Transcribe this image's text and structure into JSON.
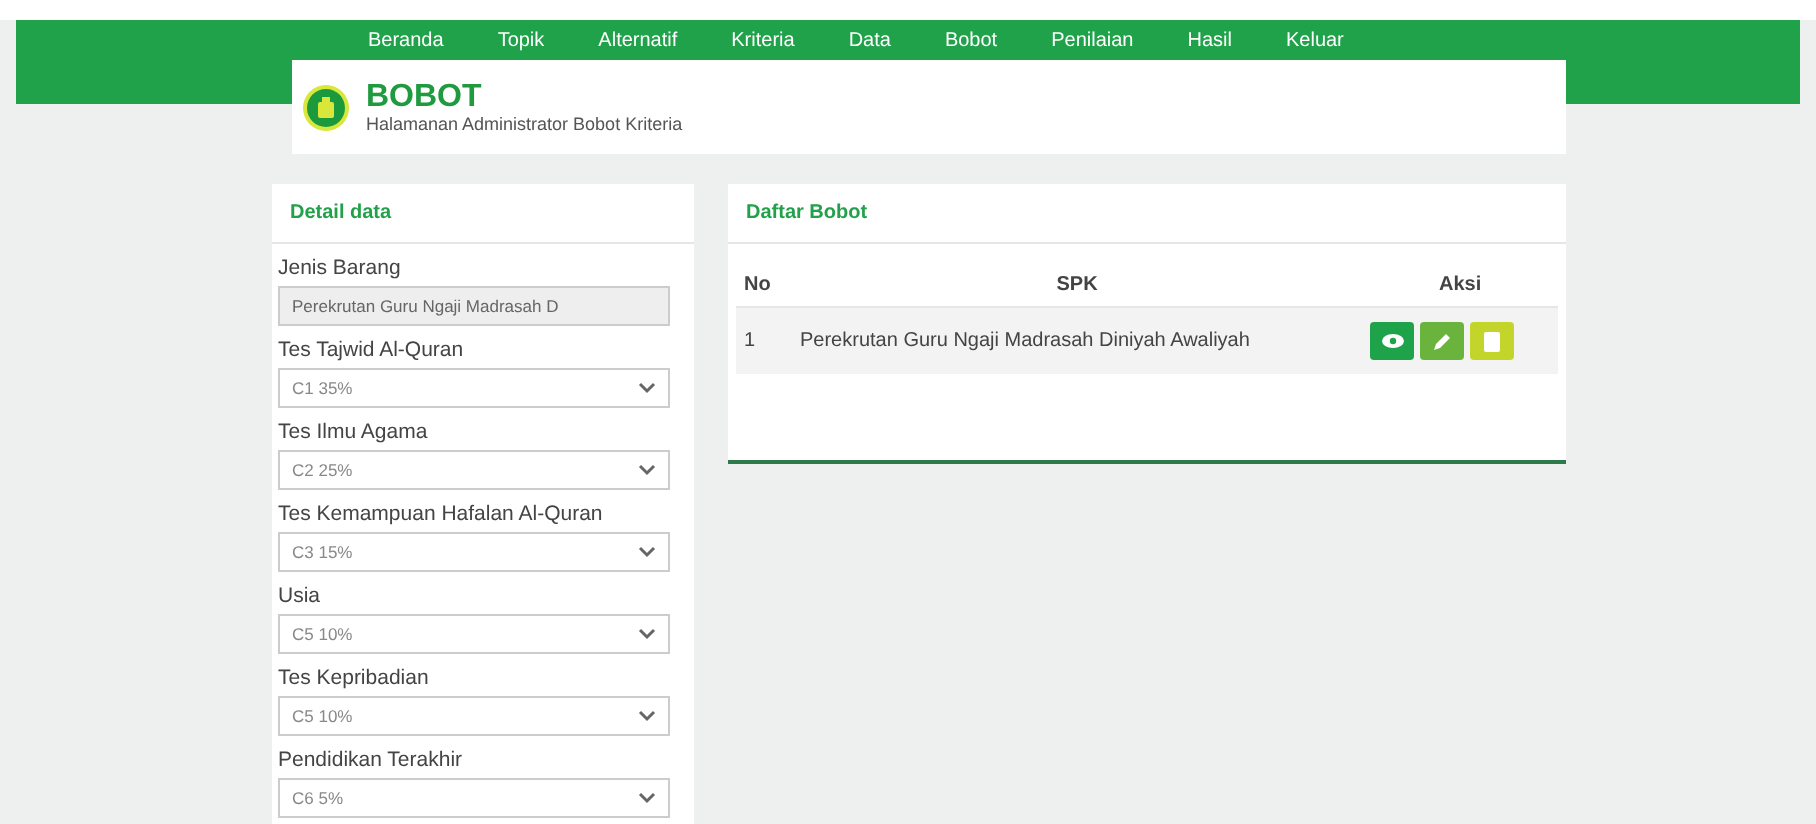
{
  "nav": [
    "Beranda",
    "Topik",
    "Alternatif",
    "Kriteria",
    "Data",
    "Bobot",
    "Penilaian",
    "Hasil",
    "Keluar"
  ],
  "header": {
    "title": "BOBOT",
    "subtitle": "Halamanan Administrator Bobot Kriteria"
  },
  "detail": {
    "title": "Detail data",
    "fields": [
      {
        "kind": "text",
        "label": "Jenis Barang",
        "value": "Perekrutan Guru Ngaji Madrasah D"
      },
      {
        "kind": "select",
        "label": "Tes Tajwid Al-Quran",
        "value": "C1 35%"
      },
      {
        "kind": "select",
        "label": "Tes Ilmu Agama",
        "value": "C2 25%"
      },
      {
        "kind": "select",
        "label": "Tes Kemampuan Hafalan Al-Quran",
        "value": "C3 15%"
      },
      {
        "kind": "select",
        "label": "Usia",
        "value": "C5 10%"
      },
      {
        "kind": "select",
        "label": "Tes Kepribadian",
        "value": "C5 10%"
      },
      {
        "kind": "select",
        "label": "Pendidikan Terakhir",
        "value": "C6 5%"
      }
    ]
  },
  "list": {
    "title": "Daftar Bobot",
    "columns": [
      "No",
      "SPK",
      "Aksi"
    ],
    "rows": [
      {
        "no": "1",
        "spk": "Perekrutan Guru Ngaji Madrasah Diniyah Awaliyah",
        "actions": [
          {
            "kind": "view"
          },
          {
            "kind": "edit"
          },
          {
            "kind": "delete"
          }
        ]
      }
    ]
  }
}
